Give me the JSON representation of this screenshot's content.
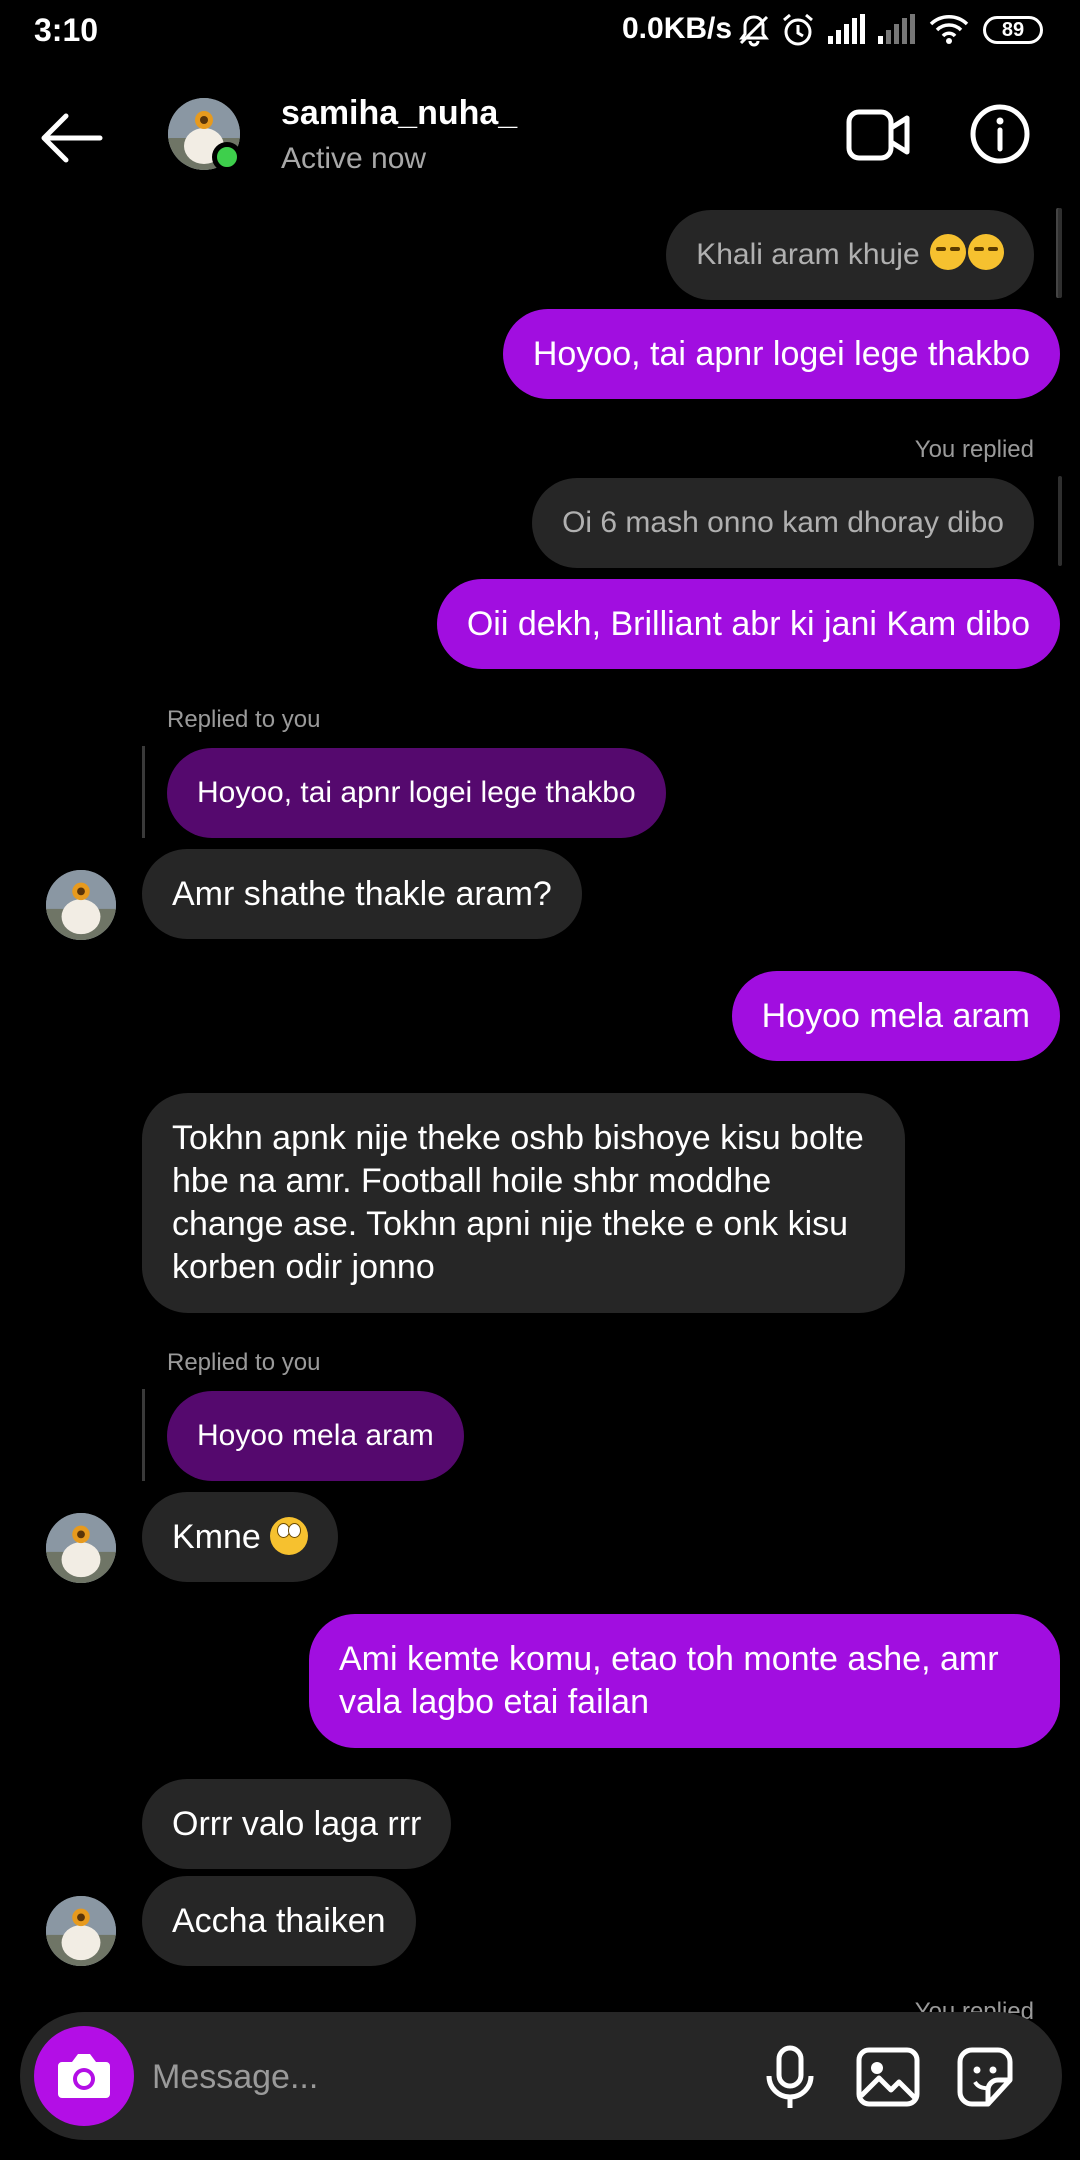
{
  "status_bar": {
    "time": "3:10",
    "net_speed": "0.0KB/s",
    "battery": "89",
    "icons": [
      "mute-icon",
      "alarm-icon",
      "signal-icon",
      "signal-weak-icon",
      "wifi-icon",
      "battery-icon"
    ]
  },
  "header": {
    "username": "samiha_nuha_",
    "status": "Active now",
    "icons": [
      "back-arrow-icon",
      "video-call-icon",
      "info-icon"
    ]
  },
  "messages": [
    {
      "kind": "quoted",
      "text": "Khali aram khuje",
      "emoji": "unamused-face-x2"
    },
    {
      "kind": "sent",
      "text": "Hoyoo, tai apnr logei lege thakbo"
    },
    {
      "kind": "label",
      "text": "You replied"
    },
    {
      "kind": "quoted",
      "text": "Oi 6 mash onno kam dhoray dibo"
    },
    {
      "kind": "sent",
      "text": "Oii dekh, Brilliant abr ki jani Kam dibo"
    },
    {
      "kind": "label",
      "text": "Replied to you"
    },
    {
      "kind": "quoted",
      "text": "Hoyoo, tai apnr logei lege thakbo"
    },
    {
      "kind": "received",
      "text": "Amr shathe thakle aram?"
    },
    {
      "kind": "sent",
      "text": "Hoyoo mela aram"
    },
    {
      "kind": "received",
      "text": "Tokhn apnk nije theke oshb bishoye kisu bolte hbe na amr. Football hoile shbr moddhe change ase. Tokhn apni nije theke e onk kisu korben odir jonno"
    },
    {
      "kind": "label",
      "text": "Replied to you"
    },
    {
      "kind": "quoted",
      "text": "Hoyoo mela aram"
    },
    {
      "kind": "received",
      "text": "Kmne",
      "emoji": "face-with-rolling-eyes"
    },
    {
      "kind": "sent",
      "text": "Ami kemte komu, etao toh monte ashe, amr vala lagbo etai failan"
    },
    {
      "kind": "received",
      "text": "Orrr valo laga rrr"
    },
    {
      "kind": "received",
      "text": "Accha thaiken"
    },
    {
      "kind": "label",
      "text": "You replied"
    }
  ],
  "composer": {
    "placeholder": "Message...",
    "icons": [
      "camera-icon",
      "microphone-icon",
      "gallery-icon",
      "sticker-icon"
    ]
  },
  "colors": {
    "background": "#000000",
    "sent_bubble": "#a10ee0",
    "received_bubble": "#262626",
    "quoted_received": "#55096e",
    "online": "#3ecf4c",
    "camera_button": "#b30ee6"
  }
}
